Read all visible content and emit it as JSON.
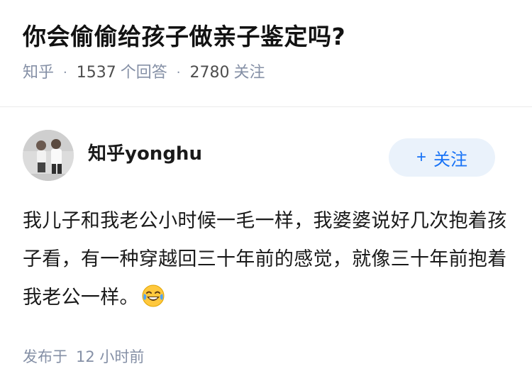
{
  "question": {
    "title": "你会偷偷给孩子做亲子鉴定吗?",
    "source": "知乎",
    "answer_count": "1537",
    "answer_label": "个回答",
    "follower_count": "2780",
    "follower_label": "关注"
  },
  "answer": {
    "author_name": "知乎yonghu",
    "follow_button": "关注",
    "follow_icon": "plus-icon",
    "text": "我儿子和我老公小时候一毛一样，我婆婆说好几次抱着孩子看，有一种穿越回三十年前的感觉，就像三十年前抱着我老公一样。",
    "emoji": "laughing-tears-emoji",
    "published_label": "发布于",
    "published_time": "12 小时前"
  },
  "colors": {
    "meta_gray": "#8590a6",
    "accent_blue": "#1772f6",
    "follow_bg": "#eaf2fb"
  }
}
